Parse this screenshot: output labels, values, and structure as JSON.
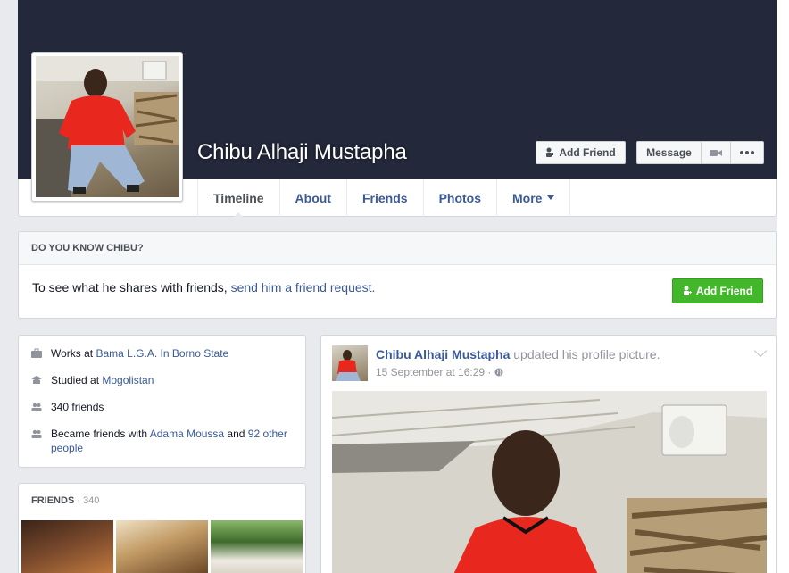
{
  "profile": {
    "name": "Chibu Alhaji Mustapha"
  },
  "actions": {
    "add_friend": "Add Friend",
    "message": "Message"
  },
  "tabs": [
    {
      "label": "Timeline"
    },
    {
      "label": "About"
    },
    {
      "label": "Friends"
    },
    {
      "label": "Photos"
    },
    {
      "label": "More"
    }
  ],
  "know": {
    "heading": "DO YOU KNOW CHIBU?",
    "text": "To see what he shares with friends, ",
    "link": "send him a friend request.",
    "button": "Add Friend"
  },
  "intro": {
    "work_prefix": "Works at ",
    "work_link": "Bama L.G.A. In Borno State",
    "study_prefix": "Studied at ",
    "study_link": "Mogolistan",
    "friends_count": "340 friends",
    "became_prefix": "Became friends with ",
    "became_link1": "Adama Moussa",
    "became_and": " and ",
    "became_link2": "92 other people"
  },
  "friends_card": {
    "heading": "FRIENDS",
    "sep": " · ",
    "count": "340"
  },
  "post": {
    "author": "Chibu Alhaji Mustapha",
    "action": " updated his profile picture.",
    "time": "15 September at 16:29 · "
  },
  "colors": {
    "cover": "#23283a",
    "link": "#3b5998",
    "green": "#42b72a",
    "shirt": "#e8281e"
  }
}
